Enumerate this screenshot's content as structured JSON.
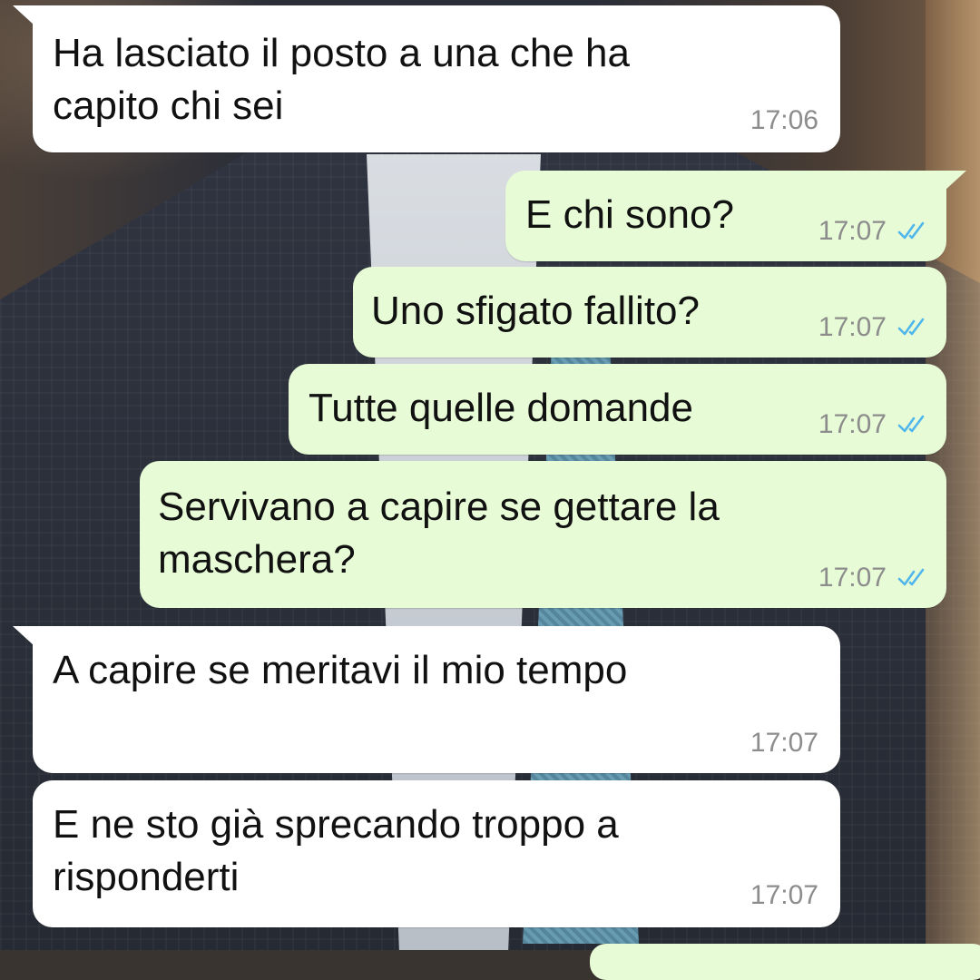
{
  "messages": [
    {
      "direction": "in",
      "text": "Ha lasciato il posto a una che ha\ncapito chi sei",
      "time": "17:06"
    },
    {
      "direction": "out",
      "text": "E chi sono?",
      "time": "17:07",
      "status": "read"
    },
    {
      "direction": "out",
      "text": "Uno sfigato fallito?",
      "time": "17:07",
      "status": "read"
    },
    {
      "direction": "out",
      "text": "Tutte quelle domande",
      "time": "17:07",
      "status": "read"
    },
    {
      "direction": "out",
      "text": "Servivano a capire se gettare la\nmaschera?",
      "time": "17:07",
      "status": "read"
    },
    {
      "direction": "in",
      "text": "A capire se meritavi il mio tempo",
      "time": "17:07"
    },
    {
      "direction": "in",
      "text": "E ne sto già sprecando troppo a\nrisponderti",
      "time": "17:07"
    }
  ],
  "colors": {
    "incoming_bubble": "#ffffff",
    "outgoing_bubble": "#e7fcd6",
    "read_ticks": "#4fb6ec",
    "timestamp": "#8c8c8c"
  },
  "icons": {
    "read_status": "double-check-icon"
  }
}
